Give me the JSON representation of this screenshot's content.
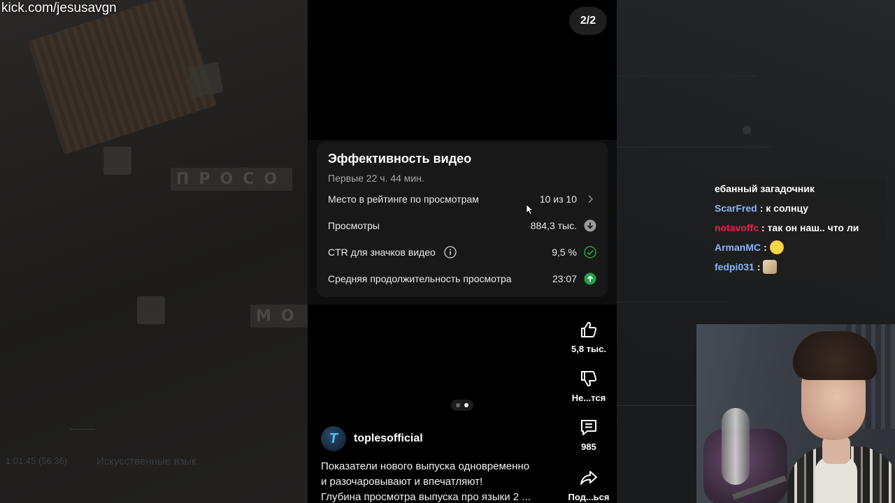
{
  "watermark": "kick.com/jesusavgn",
  "background": {
    "left_letters_1": "ПРОСО",
    "left_letters_2": "МО",
    "left_timestamp": "1:01:45 (56:36)",
    "left_caption": "Искусственные язык"
  },
  "short": {
    "page_counter": "2/2",
    "card": {
      "title": "Эффективность видео",
      "subtitle": "Первые 22 ч. 44 мин.",
      "rows": [
        {
          "label": "Место в рейтинге по просмотрам",
          "value": "10 из 10",
          "icon": "chevron-right-icon"
        },
        {
          "label": "Просмотры",
          "value": "884,3 тыс.",
          "icon": "arrow-down-circle-icon"
        },
        {
          "label": "CTR для значков видео",
          "value": "9,5 %",
          "icon": "check-circle-icon"
        },
        {
          "label": "Средняя продолжительность просмотра",
          "value": "23:07",
          "icon": "arrow-up-circle-icon"
        }
      ]
    },
    "channel": {
      "avatar_letter": "T",
      "name": "toplesofficial"
    },
    "description": [
      "Показатели нового выпуска одновременно",
      "и разочаровывают и впечатляют!",
      "Глубина просмотра выпуска про языки 2 ..."
    ],
    "actions": {
      "like": "5,8 тыс.",
      "dislike": "Не...тся",
      "comments": "985",
      "share": "Под...ься"
    }
  },
  "chat": [
    {
      "user": "",
      "message": "ебанный загадочник",
      "color": "#ffffff"
    },
    {
      "user": "ScarFred",
      "message": "к солнцу",
      "color": "#8ab4f8"
    },
    {
      "user": "notavoffc",
      "message": "так он наш.. что ли",
      "color": "#e3264b"
    },
    {
      "user": "ArmanMC",
      "message": "",
      "color": "#8ab4f8",
      "emote": "thinking-emote"
    },
    {
      "user": "fedpi031",
      "message": "",
      "color": "#8ab4f8",
      "emote": "cat-emote"
    }
  ],
  "colors": {
    "positive": "#1fa247",
    "neutral_icon": "#9a9a9a",
    "card_bg": "#181818"
  }
}
